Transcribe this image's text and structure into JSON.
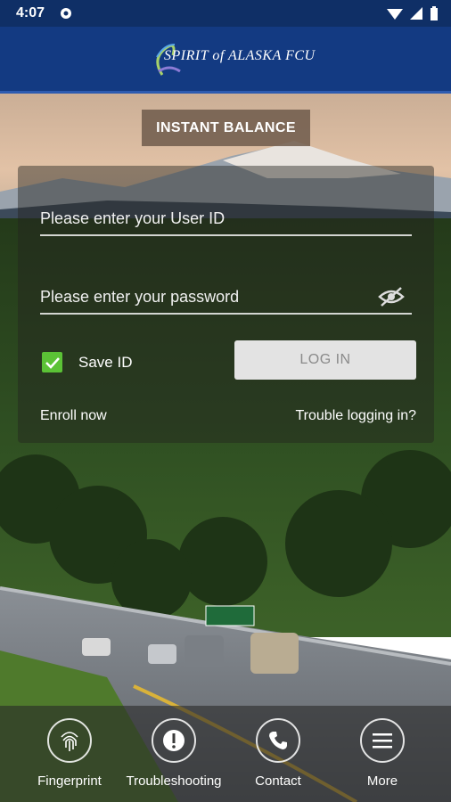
{
  "status": {
    "time": "4:07"
  },
  "header": {
    "logo_text": "SPIRIT of ALASKA FCU"
  },
  "instant_balance": "INSTANT BALANCE",
  "login": {
    "user_id_placeholder": "Please enter your User ID",
    "password_placeholder": "Please enter your password",
    "save_id_label": "Save ID",
    "save_id_checked": true,
    "login_button": "LOG IN",
    "enroll": "Enroll now",
    "trouble": "Trouble logging in?"
  },
  "nav": [
    {
      "label": "Fingerprint",
      "icon": "fingerprint-icon"
    },
    {
      "label": "Troubleshooting",
      "icon": "exclamation-icon"
    },
    {
      "label": "Contact",
      "icon": "phone-icon"
    },
    {
      "label": "More",
      "icon": "menu-icon"
    }
  ],
  "colors": {
    "header": "#133a82",
    "statusbar": "#0f2f66",
    "checkbox": "#5bc236"
  }
}
